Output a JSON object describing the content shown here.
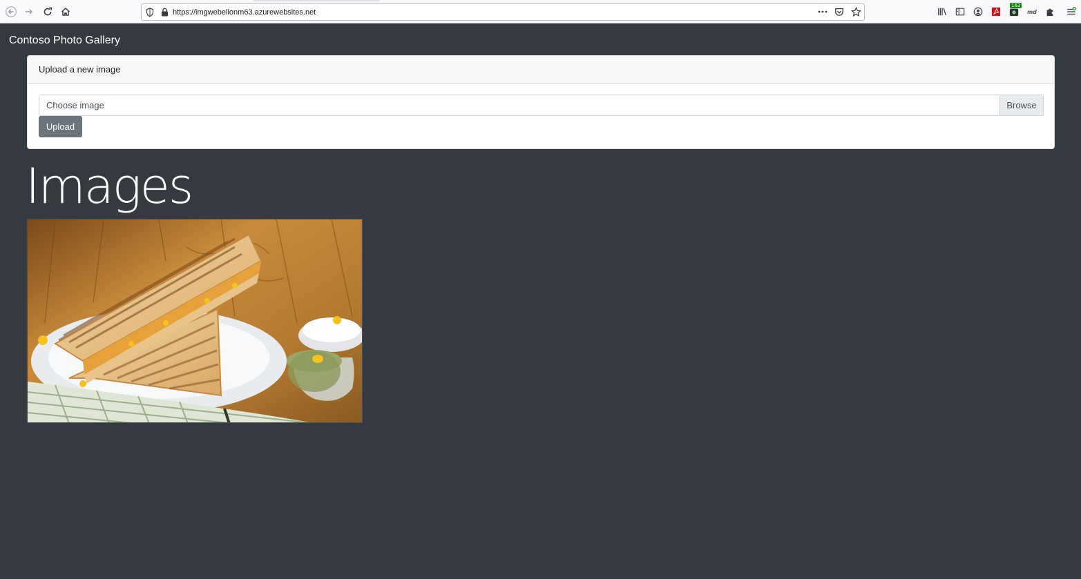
{
  "browser": {
    "url": "https://imgwebelionm63.azurewebsites.net",
    "extensions": {
      "badge_count": "163",
      "md_label": "md"
    }
  },
  "page": {
    "brand": "Contoso Photo Gallery",
    "upload_card": {
      "header": "Upload a new image",
      "file_placeholder": "Choose image",
      "browse_label": "Browse",
      "upload_label": "Upload"
    },
    "images_heading": "Images",
    "images": [
      {
        "subject": "grilled-sandwich-photo"
      }
    ]
  },
  "colors": {
    "page_background": "#343a40",
    "upload_button": "#6c757d",
    "card_header": "#f7f7f7"
  }
}
